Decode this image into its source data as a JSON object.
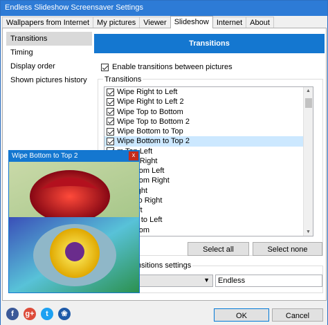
{
  "window": {
    "title": "Endless Slideshow Screensaver Settings"
  },
  "tabs": [
    {
      "label": "Wallpapers from Internet"
    },
    {
      "label": "My pictures"
    },
    {
      "label": "Viewer"
    },
    {
      "label": "Slideshow"
    },
    {
      "label": "Internet"
    },
    {
      "label": "About"
    }
  ],
  "sidebar": {
    "items": [
      {
        "label": "Transitions"
      },
      {
        "label": "Timing"
      },
      {
        "label": "Display order"
      },
      {
        "label": "Shown pictures history"
      }
    ]
  },
  "main": {
    "header": "Transitions",
    "enable_label": "Enable transitions between pictures",
    "group_label": "Transitions",
    "transitions": [
      "Wipe Right to Left",
      "Wipe Right to Left 2",
      "Wipe Top to Bottom",
      "Wipe Top to Bottom 2",
      "Wipe Bottom to Top",
      "Wipe Bottom to Top 2",
      "m Top Left",
      "m Top Right",
      "m Bottom Left",
      "m Bottom Right",
      "t to Right",
      "t Left to Right",
      "t to Left",
      "t Right to Left",
      "to Bottom"
    ],
    "select_all": "Select all",
    "select_none": "Select none",
    "settings_label": "nsitions settings",
    "text_value": "Endless"
  },
  "preview": {
    "title": "Wipe Bottom to Top 2",
    "close": "x"
  },
  "footer": {
    "ok": "OK",
    "cancel": "Cancel",
    "social": [
      {
        "name": "facebook-icon",
        "glyph": "f",
        "color": "#3b5998"
      },
      {
        "name": "google-plus-icon",
        "glyph": "g+",
        "color": "#dd4b39"
      },
      {
        "name": "twitter-icon",
        "glyph": "t",
        "color": "#1da1f2"
      },
      {
        "name": "windows-live-icon",
        "glyph": "❀",
        "color": "#1e5aa8"
      }
    ]
  }
}
